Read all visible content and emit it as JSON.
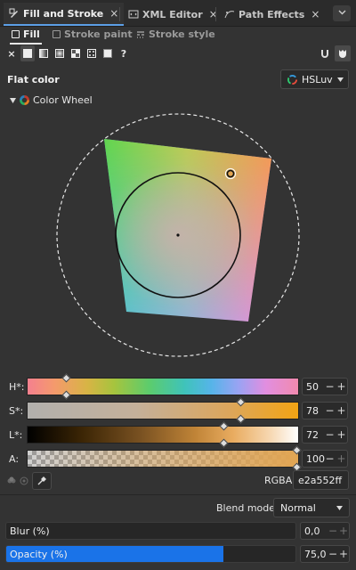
{
  "tabs": [
    {
      "label": "Fill and Stroke",
      "close": "×",
      "active": true
    },
    {
      "label": "XML Editor",
      "close": "×",
      "active": false
    },
    {
      "label": "Path Effects",
      "close": "×",
      "active": false
    }
  ],
  "tabs_dropdown_icon": "chevron-down-icon",
  "subtabs": [
    {
      "label": "Fill",
      "icon": "square-outline-icon",
      "active": true
    },
    {
      "label": "Stroke paint",
      "icon": "square-outline-icon",
      "active": false
    },
    {
      "label": "Stroke style",
      "icon": "stroke-style-icon",
      "active": false
    }
  ],
  "paint_types": {
    "x_label": "×",
    "unknown_label": "?",
    "items": [
      "no-paint-icon",
      "flat-color-icon",
      "linear-gradient-icon",
      "radial-gradient-icon",
      "mesh-gradient-icon",
      "pattern-icon",
      "swatch-icon",
      "unset-icon"
    ]
  },
  "fill_rule_icons": [
    "fill-rule-evenodd-icon",
    "fill-rule-nonzero-icon"
  ],
  "flat_color_label": "Flat color",
  "color_mode": {
    "label": "HSLuv",
    "icon": "color-wheel-icon"
  },
  "wheel_toggle_label": "Color Wheel",
  "sliders": [
    {
      "label": "H*:",
      "value": "50",
      "fraction": 0.14
    },
    {
      "label": "S*:",
      "value": "78",
      "fraction": 0.78
    },
    {
      "label": "L*:",
      "value": "72",
      "fraction": 0.72
    },
    {
      "label": "A:",
      "value": "100",
      "fraction": 1.0
    }
  ],
  "rgba": {
    "label": "RGBA:",
    "value": "e2a552ff"
  },
  "blend": {
    "label": "Blend mode:",
    "value": "Normal"
  },
  "blur": {
    "label": "Blur (%)",
    "value": "0,0",
    "fraction": 0.0
  },
  "opacity": {
    "label": "Opacity (%)",
    "value": "75,0",
    "fraction": 0.75
  },
  "spin_minus": "−",
  "spin_plus": "+",
  "colors": {
    "accent": "#1a73e8",
    "current": "#e2a552",
    "tab_underline": "#5c9fe6"
  }
}
